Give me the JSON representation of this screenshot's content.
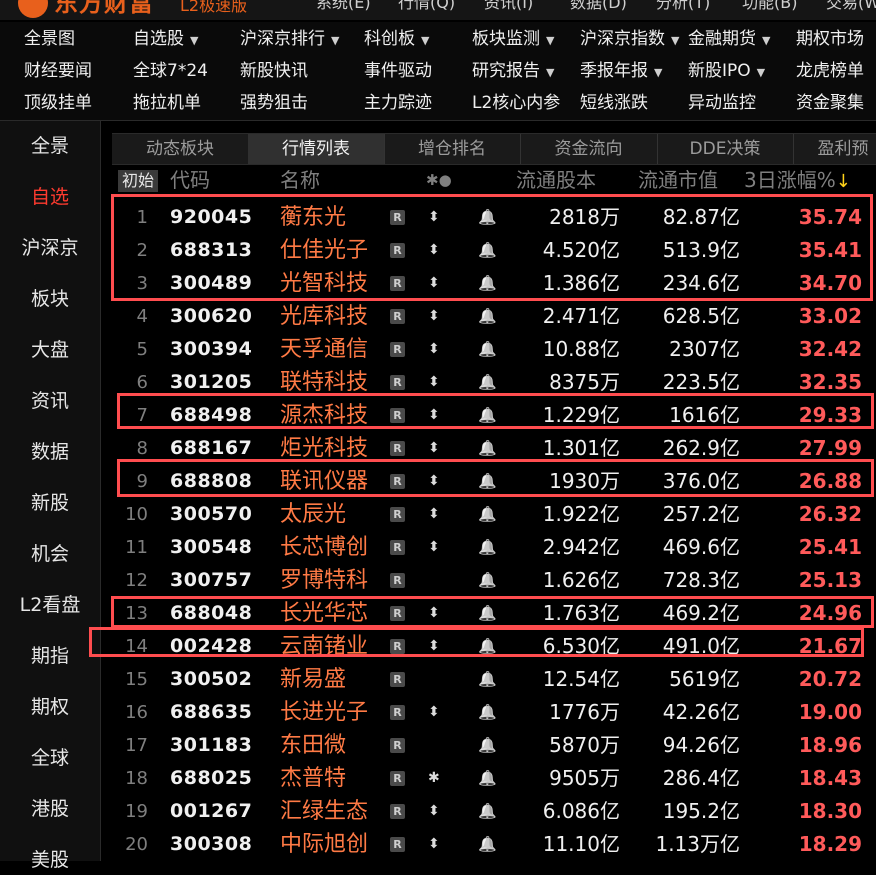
{
  "app": {
    "logo_text": "东方财富",
    "logo_sub": "L2极速版",
    "top_menu": [
      "系统(E)",
      "行情(Q)",
      "资讯(I)",
      "数据(D)",
      "分析(T)",
      "功能(B)",
      "交易(W)"
    ]
  },
  "function_grid": [
    [
      {
        "label": "全景图",
        "caret": false
      },
      {
        "label": "自选股",
        "caret": true
      },
      {
        "label": "沪深京排行",
        "caret": true
      },
      {
        "label": "科创板",
        "caret": true
      },
      {
        "label": "板块监测",
        "caret": true
      },
      {
        "label": "沪深京指数",
        "caret": true
      },
      {
        "label": "金融期货",
        "caret": true
      },
      {
        "label": "期权市场",
        "caret": false
      }
    ],
    [
      {
        "label": "财经要闻",
        "caret": false
      },
      {
        "label": "全球7*24",
        "caret": false
      },
      {
        "label": "新股快讯",
        "caret": false
      },
      {
        "label": "事件驱动",
        "caret": false
      },
      {
        "label": "研究报告",
        "caret": true
      },
      {
        "label": "季报年报",
        "caret": true
      },
      {
        "label": "新股IPO",
        "caret": true
      },
      {
        "label": "龙虎榜单",
        "caret": false
      }
    ],
    [
      {
        "label": "顶级挂单",
        "caret": false
      },
      {
        "label": "拖拉机单",
        "caret": false
      },
      {
        "label": "强势狙击",
        "caret": false
      },
      {
        "label": "主力踪迹",
        "caret": false
      },
      {
        "label": "L2核心内参",
        "caret": false
      },
      {
        "label": "短线涨跌",
        "caret": false
      },
      {
        "label": "异动监控",
        "caret": false
      },
      {
        "label": "资金聚集",
        "caret": false
      }
    ]
  ],
  "left_nav": [
    "全景",
    "自选",
    "沪深京",
    "板块",
    "大盘",
    "资讯",
    "数据",
    "新股",
    "机会",
    "L2看盘",
    "期指",
    "期权",
    "全球",
    "港股",
    "美股"
  ],
  "left_nav_active": "自选",
  "tabs": [
    "动态板块",
    "行情列表",
    "增仓排名",
    "资金流向",
    "DDE决策",
    "盈利预"
  ],
  "active_tab": "行情列表",
  "table_header": {
    "init_button": "初始",
    "code": "代码",
    "name": "名称",
    "icons": "✱●",
    "float_shares": "流通股本",
    "float_mcap": "流通市值",
    "change": "3日涨幅%",
    "sort_arrow": "↓"
  },
  "rows": [
    {
      "idx": "1",
      "code": "920045",
      "name": "蘅东光",
      "r": true,
      "flag": "pin",
      "float": "2818万",
      "mcap": "82.87亿",
      "chg": "35.74"
    },
    {
      "idx": "2",
      "code": "688313",
      "name": "仕佳光子",
      "r": true,
      "flag": "pin",
      "float": "4.520亿",
      "mcap": "513.9亿",
      "chg": "35.41"
    },
    {
      "idx": "3",
      "code": "300489",
      "name": "光智科技",
      "r": true,
      "flag": "pin",
      "float": "1.386亿",
      "mcap": "234.6亿",
      "chg": "34.70"
    },
    {
      "idx": "4",
      "code": "300620",
      "name": "光库科技",
      "r": true,
      "flag": "pin",
      "float": "2.471亿",
      "mcap": "628.5亿",
      "chg": "33.02"
    },
    {
      "idx": "5",
      "code": "300394",
      "name": "天孚通信",
      "r": true,
      "flag": "pin",
      "float": "10.88亿",
      "mcap": "2307亿",
      "chg": "32.42"
    },
    {
      "idx": "6",
      "code": "301205",
      "name": "联特科技",
      "r": true,
      "flag": "pin",
      "float": "8375万",
      "mcap": "223.5亿",
      "chg": "32.35"
    },
    {
      "idx": "7",
      "code": "688498",
      "name": "源杰科技",
      "r": true,
      "flag": "pin",
      "float": "1.229亿",
      "mcap": "1616亿",
      "chg": "29.33"
    },
    {
      "idx": "8",
      "code": "688167",
      "name": "炬光科技",
      "r": true,
      "flag": "pin",
      "float": "1.301亿",
      "mcap": "262.9亿",
      "chg": "27.99"
    },
    {
      "idx": "9",
      "code": "688808",
      "name": "联讯仪器",
      "r": true,
      "flag": "pin",
      "float": "1930万",
      "mcap": "376.0亿",
      "chg": "26.88"
    },
    {
      "idx": "10",
      "code": "300570",
      "name": "太辰光",
      "r": true,
      "flag": "pin",
      "float": "1.922亿",
      "mcap": "257.2亿",
      "chg": "26.32"
    },
    {
      "idx": "11",
      "code": "300548",
      "name": "长芯博创",
      "r": true,
      "flag": "pin",
      "float": "2.942亿",
      "mcap": "469.6亿",
      "chg": "25.41"
    },
    {
      "idx": "12",
      "code": "300757",
      "name": "罗博特科",
      "r": true,
      "flag": "",
      "float": "1.626亿",
      "mcap": "728.3亿",
      "chg": "25.13"
    },
    {
      "idx": "13",
      "code": "688048",
      "name": "长光华芯",
      "r": true,
      "flag": "pin",
      "float": "1.763亿",
      "mcap": "469.2亿",
      "chg": "24.96"
    },
    {
      "idx": "14",
      "code": "002428",
      "name": "云南锗业",
      "r": true,
      "flag": "pin",
      "float": "6.530亿",
      "mcap": "491.0亿",
      "chg": "21.67"
    },
    {
      "idx": "15",
      "code": "300502",
      "name": "新易盛",
      "r": true,
      "flag": "",
      "float": "12.54亿",
      "mcap": "5619亿",
      "chg": "20.72"
    },
    {
      "idx": "16",
      "code": "688635",
      "name": "长进光子",
      "r": true,
      "flag": "pin",
      "float": "1776万",
      "mcap": "42.26亿",
      "chg": "19.00"
    },
    {
      "idx": "17",
      "code": "301183",
      "name": "东田微",
      "r": true,
      "flag": "",
      "float": "5870万",
      "mcap": "94.26亿",
      "chg": "18.96"
    },
    {
      "idx": "18",
      "code": "688025",
      "name": "杰普特",
      "r": true,
      "flag": "star",
      "float": "9505万",
      "mcap": "286.4亿",
      "chg": "18.43"
    },
    {
      "idx": "19",
      "code": "001267",
      "name": "汇绿生态",
      "r": true,
      "flag": "pin",
      "float": "6.086亿",
      "mcap": "195.2亿",
      "chg": "18.30"
    },
    {
      "idx": "20",
      "code": "300308",
      "name": "中际旭创",
      "r": true,
      "flag": "pin",
      "float": "11.10亿",
      "mcap": "1.13万亿",
      "chg": "18.29"
    }
  ],
  "colors": {
    "accent_red": "#ff4d4f",
    "name_orange": "#ff7a45",
    "change_red": "#ff5a5a",
    "brand_orange": "#e8601c"
  }
}
